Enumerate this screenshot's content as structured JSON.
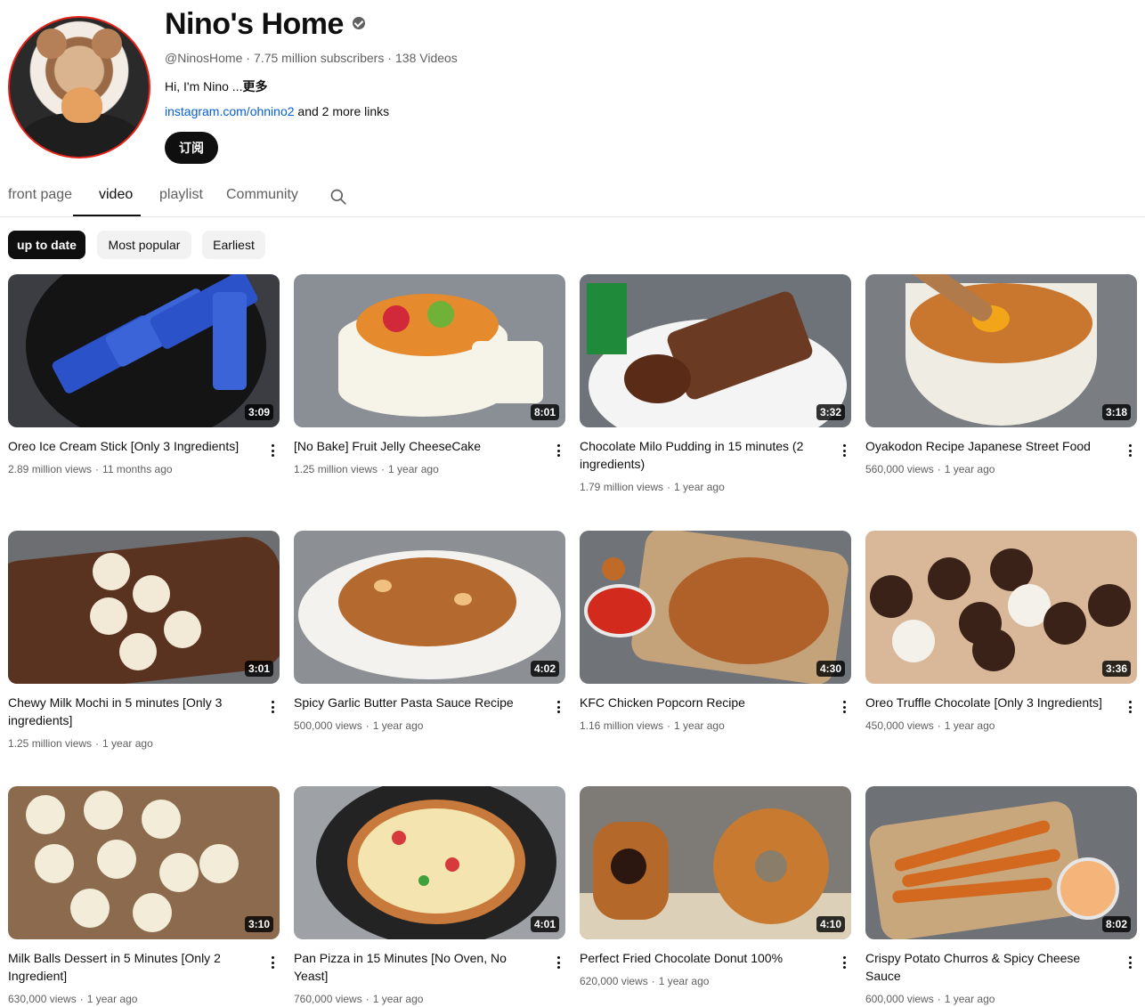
{
  "channel": {
    "name": "Nino's Home",
    "handle": "@NinosHome",
    "subscribers": "7.75 million subscribers",
    "video_count": "138 Videos",
    "description": "Hi, I'm Nino ...",
    "more_label": "更多",
    "link_text": "instagram.com/ohnino2",
    "more_links": " and 2 more links",
    "subscribe_label": "订阅",
    "meta_separator": "·"
  },
  "tabs": [
    {
      "label": "front page",
      "active": false
    },
    {
      "label": "video",
      "active": true
    },
    {
      "label": "playlist",
      "active": false
    },
    {
      "label": "Community",
      "active": false
    }
  ],
  "chips": [
    {
      "label": "up to date",
      "active": true
    },
    {
      "label": "Most popular",
      "active": false
    },
    {
      "label": "Earliest",
      "active": false
    }
  ],
  "videos": [
    {
      "title": "Oreo Ice Cream Stick [Only 3 Ingredients]",
      "views": "2.89 million views",
      "age": "11 months ago",
      "duration": "3:09"
    },
    {
      "title": "[No Bake] Fruit Jelly CheeseCake",
      "views": "1.25 million views",
      "age": "1 year ago",
      "duration": "8:01"
    },
    {
      "title": "Chocolate Milo Pudding in 15 minutes (2 ingredients)",
      "views": "1.79 million views",
      "age": "1 year ago",
      "duration": "3:32"
    },
    {
      "title": "Oyakodon Recipe Japanese Street Food",
      "views": "560,000 views",
      "age": "1 year ago",
      "duration": "3:18"
    },
    {
      "title": "Chewy Milk Mochi in 5 minutes [Only 3 ingredients]",
      "views": "1.25 million views",
      "age": "1 year ago",
      "duration": "3:01"
    },
    {
      "title": "Spicy Garlic Butter Pasta Sauce Recipe",
      "views": "500,000 views",
      "age": "1 year ago",
      "duration": "4:02"
    },
    {
      "title": "KFC Chicken Popcorn Recipe",
      "views": "1.16 million views",
      "age": "1 year ago",
      "duration": "4:30"
    },
    {
      "title": "Oreo Truffle Chocolate [Only 3 Ingredients]",
      "views": "450,000 views",
      "age": "1 year ago",
      "duration": "3:36"
    },
    {
      "title": "Milk Balls Dessert in 5 Minutes [Only 2 Ingredient]",
      "views": "630,000 views",
      "age": "1 year ago",
      "duration": "3:10"
    },
    {
      "title": "Pan Pizza in 15 Minutes [No Oven, No Yeast]",
      "views": "760,000 views",
      "age": "1 year ago",
      "duration": "4:01"
    },
    {
      "title": "Perfect Fried Chocolate Donut 100%",
      "views": "620,000 views",
      "age": "1 year ago",
      "duration": "4:10"
    },
    {
      "title": "Crispy Potato Churros & Spicy Cheese Sauce",
      "views": "600,000 views",
      "age": "1 year ago",
      "duration": "8:02"
    }
  ],
  "colors": {
    "accent_red": "#e62117",
    "link_blue": "#065fd4",
    "text_primary": "#0f0f0f",
    "text_secondary": "#606060",
    "chip_bg": "#f2f2f2"
  }
}
